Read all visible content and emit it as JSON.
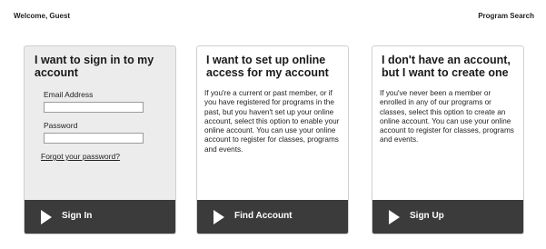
{
  "header": {
    "welcome": "Welcome, Guest",
    "program_search": "Program Search"
  },
  "cards": {
    "signin": {
      "title": "I want to sign in to my account",
      "email_label": "Email Address",
      "email_value": "",
      "password_label": "Password",
      "password_value": "",
      "forgot_link": "Forgot your password?",
      "button": "Sign In",
      "button_icon": "play-icon"
    },
    "setup": {
      "title": "I want to set up online access for my account",
      "body": "If you're a current or past member, or if you have registered for programs in the past, but you haven't set up your online account, select this option to enable your online account. You can use your online account to register for classes, programs and events.",
      "button": "Find Account",
      "button_icon": "play-icon"
    },
    "create": {
      "title": "I don't have an account, but I want to create one",
      "body": "If you've never been a member or enrolled in any of our programs or classes, select this option to create an online account. You can use your online account to register for classes, programs and events.",
      "button": "Sign Up",
      "button_icon": "play-icon"
    }
  },
  "colors": {
    "button_bg": "#3b3b3b",
    "signin_card_bg": "#ececec",
    "card_border": "#cfcfcf"
  }
}
